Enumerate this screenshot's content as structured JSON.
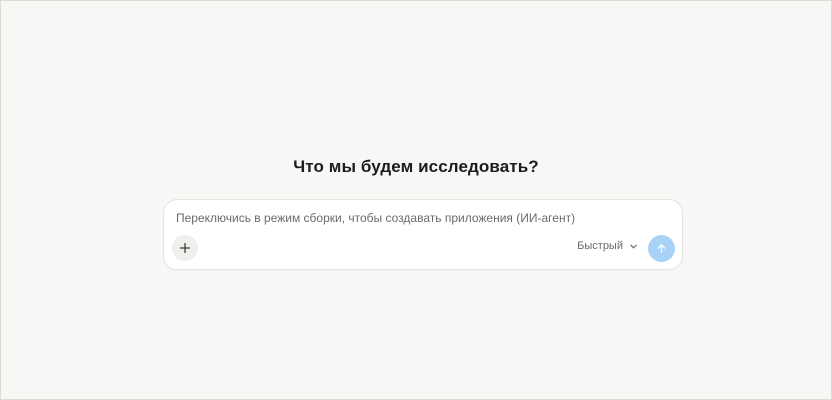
{
  "main": {
    "heading": "Что мы будем исследовать?"
  },
  "composer": {
    "placeholder": "Переключись в режим сборки, чтобы создавать приложения (ИИ-агент)",
    "mode_label": "Быстрый",
    "attach_icon": "plus-icon",
    "mode_icon": "chevron-down-icon",
    "send_icon": "arrow-up-icon"
  },
  "colors": {
    "background": "#f8f7f5",
    "send_button": "#a8d2f6",
    "attach_button": "#f0efec"
  }
}
